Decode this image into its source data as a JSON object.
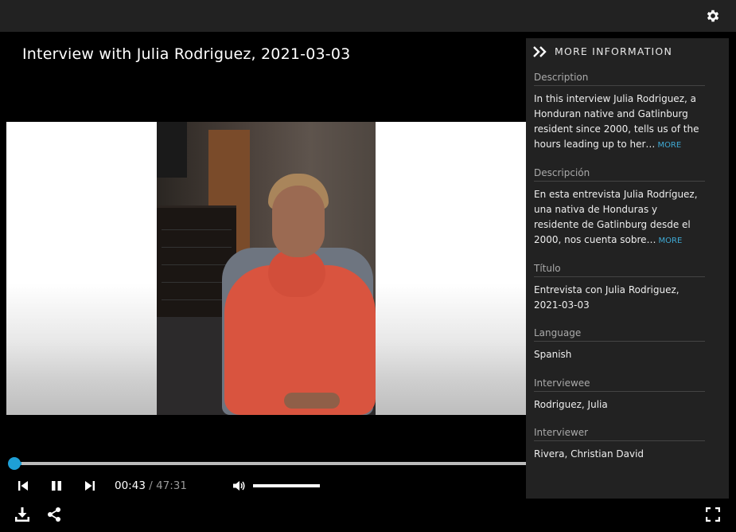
{
  "topbar": {
    "settings_icon": "gear-icon"
  },
  "video": {
    "title": "Interview with Julia Rodriguez, 2021-03-03",
    "progress_fraction": 0.015
  },
  "panel": {
    "header": "MORE INFORMATION",
    "toggle_icon": "double-chevron-right-icon",
    "sections": [
      {
        "label": "Description",
        "text": "In this interview Julia Rodriguez, a Honduran native and Gatlinburg resident since 2000, tells us of the hours leading up to her…",
        "more": "MORE"
      },
      {
        "label": "Descripción",
        "text": "En esta entrevista Julia Rodríguez, una nativa de Honduras y residente de Gatlinburg desde el 2000, nos cuenta sobre…",
        "more": "MORE"
      },
      {
        "label": "Título",
        "text": "Entrevista con Julia Rodriguez, 2021-03-03"
      },
      {
        "label": "Language",
        "text": "Spanish"
      },
      {
        "label": "Interviewee",
        "text": "Rodriguez, Julia"
      },
      {
        "label": "Interviewer",
        "text": "Rivera, Christian David"
      }
    ]
  },
  "controls": {
    "current_time": "00:43",
    "separator": "/",
    "duration": "47:31",
    "volume_level": 1.0,
    "icons": [
      "skip-back-icon",
      "pause-icon",
      "skip-forward-icon",
      "volume-icon",
      "download-icon",
      "share-icon",
      "fullscreen-icon"
    ]
  },
  "colors": {
    "accent": "#1e9fd6",
    "panel_bg": "#222222",
    "link": "#3fa9d4"
  }
}
